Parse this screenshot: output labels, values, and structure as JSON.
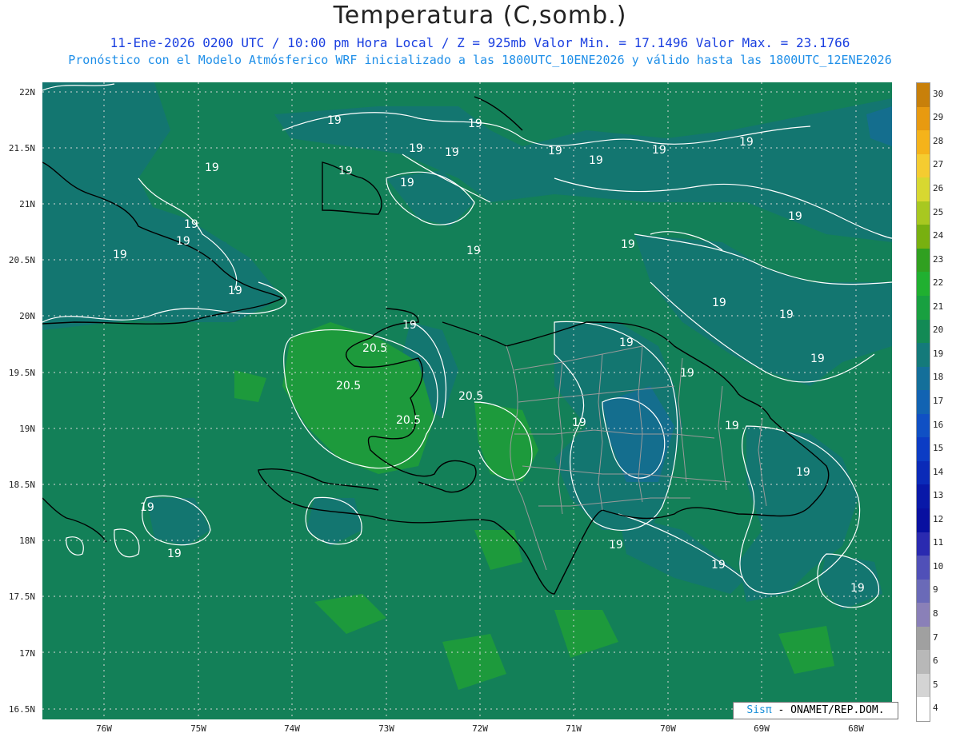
{
  "header": {
    "title": "Temperatura (C,somb.)",
    "line1": "11-Ene-2026 0200 UTC / 10:00 pm Hora Local / Z = 925mb   Valor Min. = 17.1496  Valor Max. = 23.1766",
    "line2": "Pronóstico con el Modelo Atmósferico WRF inicializado a las 1800UTC_10ENE2026 y válido hasta las  1800UTC_12ENE2026"
  },
  "axes": {
    "lat_labels": [
      "22N",
      "21.5N",
      "21N",
      "20.5N",
      "20N",
      "19.5N",
      "19N",
      "18.5N",
      "18N",
      "17.5N",
      "17N",
      "16.5N"
    ],
    "lon_labels": [
      "76W",
      "75W",
      "74W",
      "73W",
      "72W",
      "71W",
      "70W",
      "69W",
      "68W"
    ]
  },
  "contour_labels": [
    "19",
    "19",
    "19",
    "19",
    "19",
    "19",
    "19",
    "19",
    "19",
    "19",
    "19",
    "19",
    "19",
    "19",
    "19",
    "19",
    "19",
    "19",
    "19",
    "19",
    "19",
    "19",
    "19",
    "19",
    "19",
    "19",
    "19",
    "19",
    "19",
    "19",
    "19",
    "19",
    "20.5",
    "20.5",
    "20.5",
    "20.5"
  ],
  "colorbar": {
    "labels": [
      "30",
      "29",
      "28",
      "27",
      "26",
      "25",
      "24",
      "23",
      "22",
      "21",
      "20",
      "19",
      "18",
      "17",
      "16",
      "15",
      "14",
      "13",
      "12",
      "11",
      "10",
      "9",
      "8",
      "7",
      "6",
      "5",
      "4"
    ],
    "colors": [
      "#c8800a",
      "#e89a10",
      "#f5b31a",
      "#f5cc30",
      "#d8d830",
      "#a8c820",
      "#78b010",
      "#30a020",
      "#20b030",
      "#18a040",
      "#138a55",
      "#147a7a",
      "#146f9a",
      "#1263b2",
      "#1050c4",
      "#0c3cc4",
      "#0a2ab8",
      "#0818a8",
      "#0810a0",
      "#2a2ab0",
      "#5050b8",
      "#6a6ab8",
      "#8a80b8",
      "#a0a0a0",
      "#b8b8b8",
      "#d4d4d4",
      "#ffffff"
    ]
  },
  "credit": {
    "brand": "Sisπ",
    "text": "- ONAMET/REP.DOM."
  },
  "colors": {
    "sea": "#127a6a",
    "land": "#148a52",
    "warm": "#1f9a3a",
    "contour": "#ffffff",
    "coast": "#000000",
    "provinces": "#9a9a9a"
  }
}
